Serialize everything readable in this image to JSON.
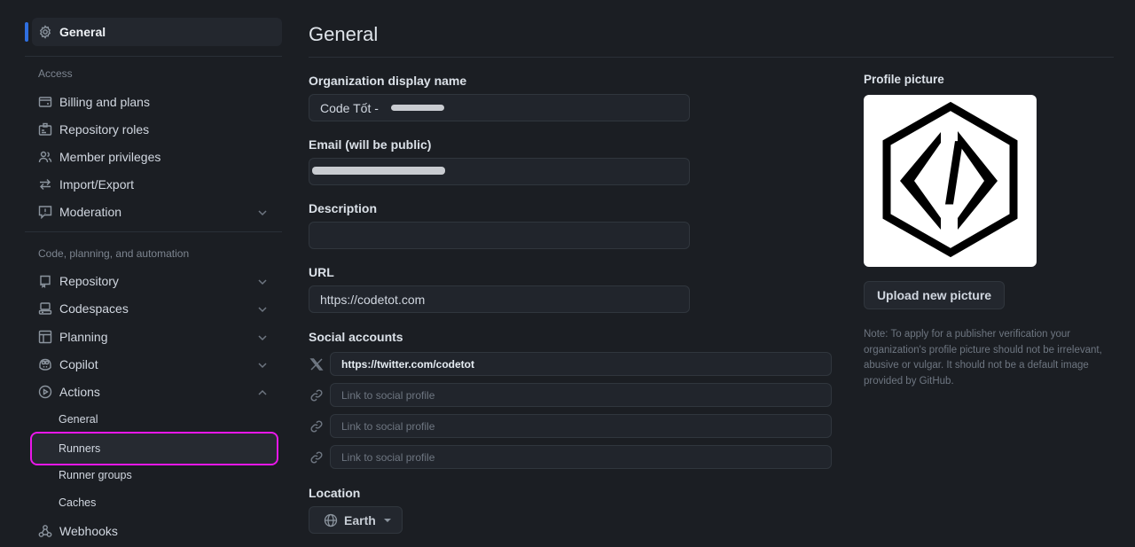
{
  "sidebar": {
    "active_item": {
      "label": "General",
      "icon": "gear-icon"
    },
    "sections": [
      {
        "label": "Access",
        "items": [
          {
            "label": "Billing and plans",
            "icon": "credit-card-icon",
            "expandable": false
          },
          {
            "label": "Repository roles",
            "icon": "id-badge-icon",
            "expandable": false
          },
          {
            "label": "Member privileges",
            "icon": "people-icon",
            "expandable": false
          },
          {
            "label": "Import/Export",
            "icon": "arrow-switch-icon",
            "expandable": false
          },
          {
            "label": "Moderation",
            "icon": "report-icon",
            "expandable": true,
            "expanded": false
          }
        ]
      },
      {
        "label": "Code, planning, and automation",
        "items": [
          {
            "label": "Repository",
            "icon": "repo-icon",
            "expandable": true,
            "expanded": false
          },
          {
            "label": "Codespaces",
            "icon": "codespaces-icon",
            "expandable": true,
            "expanded": false
          },
          {
            "label": "Planning",
            "icon": "table-icon",
            "expandable": true,
            "expanded": false
          },
          {
            "label": "Copilot",
            "icon": "copilot-icon",
            "expandable": true,
            "expanded": false
          },
          {
            "label": "Actions",
            "icon": "play-icon",
            "expandable": true,
            "expanded": true
          }
        ]
      }
    ],
    "actions_subitems": [
      {
        "label": "General"
      },
      {
        "label": "Runners",
        "highlighted": true
      },
      {
        "label": "Runner groups"
      },
      {
        "label": "Caches"
      }
    ],
    "trailing_item": {
      "label": "Webhooks",
      "icon": "webhook-icon"
    }
  },
  "main": {
    "title": "General",
    "fields": {
      "display_name": {
        "label": "Organization display name",
        "value": "Code Tốt - "
      },
      "email": {
        "label": "Email (will be public)",
        "value": ""
      },
      "description": {
        "label": "Description",
        "value": ""
      },
      "url": {
        "label": "URL",
        "value": "https://codetot.com"
      }
    },
    "social": {
      "label": "Social accounts",
      "accounts": [
        {
          "icon": "x-twitter-icon",
          "value": "https://twitter.com/codetot",
          "placeholder": "Link to social profile"
        },
        {
          "icon": "link-icon",
          "value": "",
          "placeholder": "Link to social profile"
        },
        {
          "icon": "link-icon",
          "value": "",
          "placeholder": "Link to social profile"
        },
        {
          "icon": "link-icon",
          "value": "",
          "placeholder": "Link to social profile"
        }
      ]
    },
    "location": {
      "label": "Location",
      "value": "Earth"
    }
  },
  "profile": {
    "label": "Profile picture",
    "upload_label": "Upload new picture",
    "note": "Note: To apply for a publisher verification your organization's profile picture should not be irrelevant, abusive or vulgar. It should not be a default image provided by GitHub."
  },
  "colors": {
    "background": "#1b1e23",
    "active_accent": "#2f6fe0",
    "highlight_outline": "#ea17ea"
  }
}
